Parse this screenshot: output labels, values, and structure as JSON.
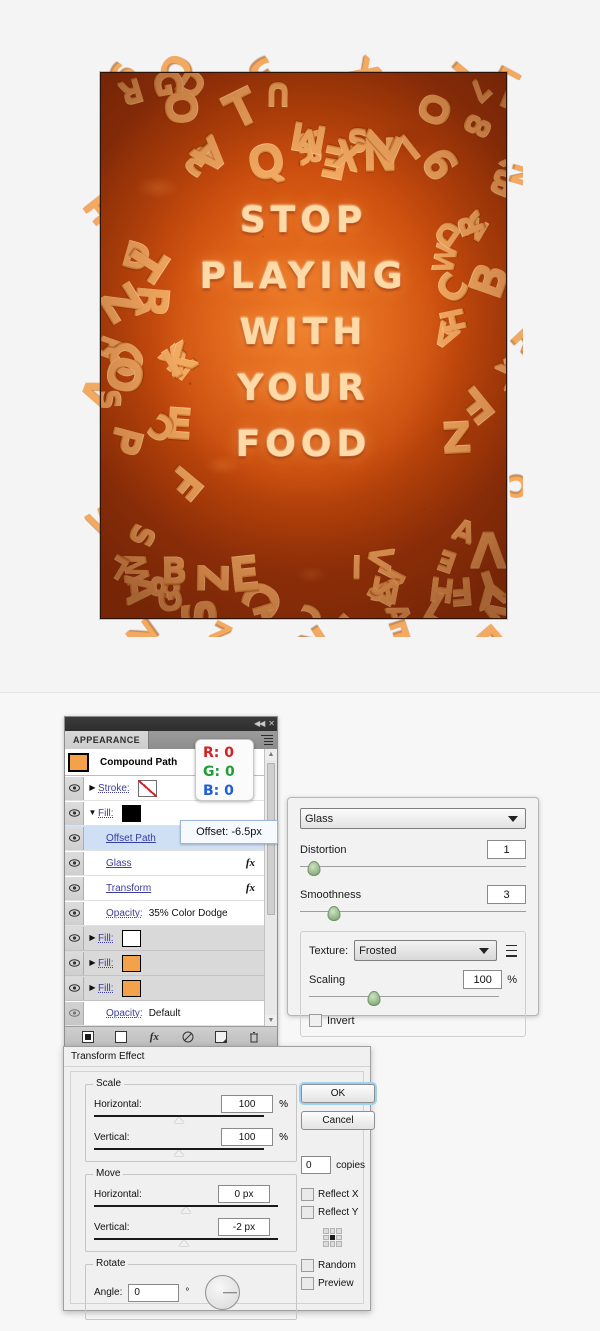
{
  "artwork": {
    "message_lines": [
      "STOP",
      "PLAYING",
      "WITH",
      "YOUR",
      "FOOD"
    ],
    "border_letters": "RAT9EINDOUMLO3QA78X7GSXRZTY8LIGFCHB2Z1AMSCJWAVLENHXQDRKFSECSTPOZBAFBZAVANKHCWDE",
    "colors": {
      "sauce": "#d9561a",
      "letters": "#f2aa62",
      "frame": "#2a1206"
    }
  },
  "appearance_panel": {
    "tab_label": "APPEARANCE",
    "titlebar": {
      "collapse_icon": "collapse-icon",
      "close_icon": "close-icon"
    },
    "menu_icon": "panel-menu-icon",
    "target_label": "Compound Path",
    "rows": [
      {
        "label": "Stroke:",
        "swatch": "none",
        "kind": "stroke",
        "disclosure": "right"
      },
      {
        "label": "Fill:",
        "swatch": "black",
        "kind": "fill",
        "disclosure": "down"
      },
      {
        "label": "Offset Path",
        "kind": "effect",
        "selected": true
      },
      {
        "label": "Glass",
        "kind": "effect",
        "fx": "fx"
      },
      {
        "label": "Transform",
        "kind": "effect",
        "fx": "fx"
      },
      {
        "label": "Opacity:",
        "value": "35% Color Dodge",
        "kind": "opacity"
      },
      {
        "label": "Fill:",
        "swatch": "white",
        "kind": "fill",
        "disclosure": "right",
        "gray": true
      },
      {
        "label": "Fill:",
        "swatch": "orange",
        "kind": "fill",
        "disclosure": "right",
        "gray": true
      },
      {
        "label": "Fill:",
        "swatch": "orange",
        "kind": "fill",
        "disclosure": "right",
        "gray": true
      },
      {
        "label": "Opacity:",
        "value": "Default",
        "kind": "opacity"
      }
    ],
    "footer_icons": [
      "add-new-stroke-icon",
      "add-new-fill-icon",
      "add-new-effect-icon",
      "clear-appearance-icon",
      "duplicate-item-icon",
      "delete-item-icon"
    ],
    "scrollbar": {
      "up_arrow": "▲",
      "down_arrow": "▼"
    }
  },
  "rgb_tooltip": {
    "r_label": "R:",
    "r_value": "0",
    "g_label": "G:",
    "g_value": "0",
    "b_label": "B:",
    "b_value": "0",
    "colors": {
      "r": "#d51f20",
      "g": "#1f9d36",
      "b": "#1f5fd5"
    }
  },
  "offset_tooltip": {
    "text": "Offset: -6.5px"
  },
  "glass_dialog": {
    "effect_name": "Glass",
    "distortion": {
      "label": "Distortion",
      "value": "1",
      "slider_pct": 6
    },
    "smoothness": {
      "label": "Smoothness",
      "value": "3",
      "slider_pct": 15
    },
    "texture": {
      "label": "Texture:",
      "value": "Frosted",
      "flyout_icon": "texture-options-icon"
    },
    "scaling": {
      "label": "Scaling",
      "value": "100",
      "unit": "%",
      "slider_pct": 34
    },
    "invert": {
      "label": "Invert",
      "checked": false
    }
  },
  "transform_dialog": {
    "title": "Transform Effect",
    "scale": {
      "legend": "Scale",
      "horizontal": {
        "label": "Horizontal:",
        "value": "100",
        "unit": "%",
        "slider_pct": 50
      },
      "vertical": {
        "label": "Vertical:",
        "value": "100",
        "unit": "%",
        "slider_pct": 50
      }
    },
    "move": {
      "legend": "Move",
      "horizontal": {
        "label": "Horizontal:",
        "value": "0 px",
        "slider_pct": 50
      },
      "vertical": {
        "label": "Vertical:",
        "value": "-2 px",
        "slider_pct": 49
      }
    },
    "rotate": {
      "legend": "Rotate",
      "angle_label": "Angle:",
      "angle_value": "0",
      "degree": "°"
    },
    "buttons": {
      "ok": "OK",
      "cancel": "Cancel"
    },
    "copies": {
      "value": "0",
      "label": "copies"
    },
    "reflect_x": {
      "label": "Reflect X",
      "checked": false
    },
    "reflect_y": {
      "label": "Reflect Y",
      "checked": false
    },
    "random": {
      "label": "Random",
      "checked": false
    },
    "preview": {
      "label": "Preview",
      "checked": false
    },
    "anchor": "center"
  }
}
